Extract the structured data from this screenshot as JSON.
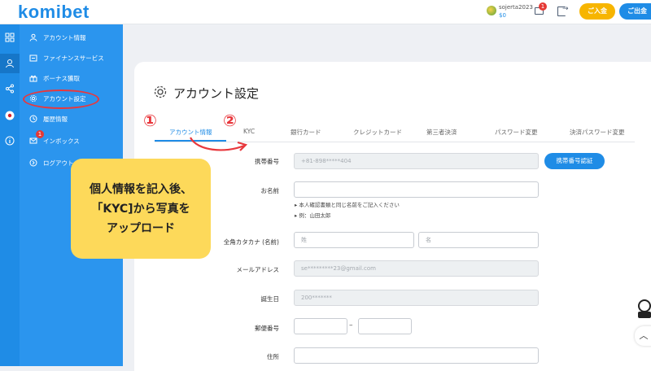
{
  "header": {
    "logo": "komibet",
    "username": "sojerta2023",
    "balance": "$0",
    "mail_badge": "1",
    "deposit_label": "ご入金",
    "withdraw_label": "ご出金"
  },
  "sidebar": {
    "items": [
      {
        "label": "アカウント情報",
        "icon": "user-icon"
      },
      {
        "label": "ファイナンスサービス",
        "icon": "finance-icon"
      },
      {
        "label": "ボーナス獲取",
        "icon": "gift-icon"
      },
      {
        "label": "アカウント設定",
        "icon": "gear-icon"
      },
      {
        "label": "履歴情報",
        "icon": "history-icon"
      },
      {
        "label": "インボックス",
        "icon": "mail-icon",
        "badge": "1"
      },
      {
        "label": "ログアウト",
        "icon": "logout-icon"
      }
    ]
  },
  "annotation": {
    "lines": [
      "個人情報を記入後、",
      "「KYC]から写真を",
      "アップロード"
    ],
    "step1": "①",
    "step2": "②",
    "highlight_color": "#e8383d",
    "bubble_color": "#fdd95a"
  },
  "page": {
    "title": "アカウント設定",
    "tabs": [
      "アカウント情報",
      "KYC",
      "銀行カード",
      "クレジットカード",
      "第三者決済",
      "パスワード変更",
      "決済パスワード変更"
    ],
    "active_tab": "アカウント情報"
  },
  "form": {
    "phone_label": "携帯番号",
    "phone_value": "+81-898*****404",
    "verify_button": "携帯番号認証",
    "name_label": "お名前",
    "name_hint_1": "▸ 本人確認書類と同じ名前をご記入ください",
    "name_hint_2": "▸ 例：山田太郎",
    "kana_label": "全角カタカナ (名前)",
    "kana_last_placeholder": "姓",
    "kana_first_placeholder": "名",
    "email_label": "メールアドレス",
    "email_value": "se*********23@gmail.com",
    "birthday_label": "誕生日",
    "birthday_value": "200*******",
    "postal_label": "郵便番号",
    "postal_dash": "–",
    "address_label": "住所"
  },
  "colors": {
    "brand": "#1f8ce6",
    "sidebar": "#2b95ee",
    "deposit": "#f7b500"
  }
}
